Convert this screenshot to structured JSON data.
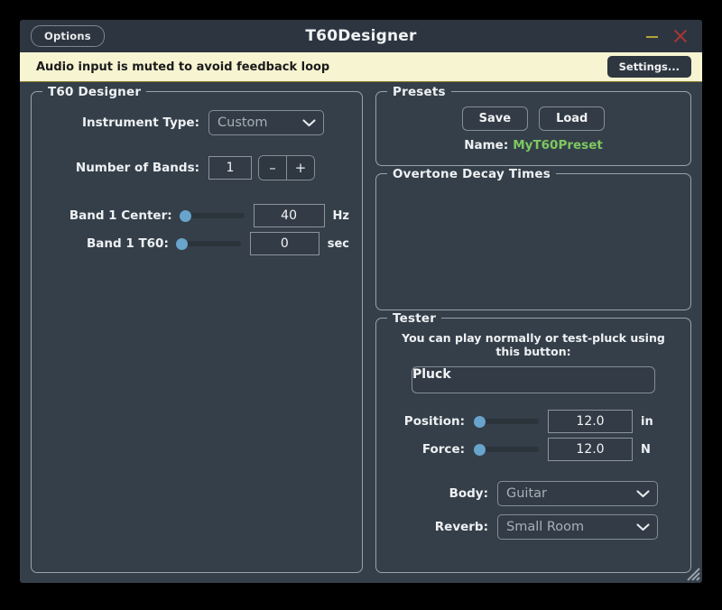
{
  "window": {
    "title": "T60Designer",
    "options_button": "Options",
    "minimize_icon": "minimize-icon",
    "close_icon": "close-icon"
  },
  "banner": {
    "message": "Audio input is muted to avoid feedback loop",
    "settings_button": "Settings...",
    "background_color": "#f7f4d2",
    "text_color": "#1b1b1b"
  },
  "designer": {
    "legend": "T60 Designer",
    "instrument_type_label": "Instrument Type:",
    "instrument_type_value": "Custom",
    "num_bands_label": "Number of Bands:",
    "num_bands_value": "1",
    "decrement_label": "–",
    "increment_label": "+",
    "bands": [
      {
        "center_label": "Band 1 Center:",
        "center_value": "40",
        "center_unit": "Hz",
        "center_slider_percent": 0,
        "t60_label": "Band 1 T60:",
        "t60_value": "0",
        "t60_unit": "sec",
        "t60_slider_percent": 0
      }
    ]
  },
  "presets": {
    "legend": "Presets",
    "save_button": "Save",
    "load_button": "Load",
    "name_label": "Name:",
    "name_value": "MyT60Preset",
    "name_color": "#7ec860"
  },
  "overtone": {
    "legend": "Overtone Decay Times",
    "items": []
  },
  "tester": {
    "legend": "Tester",
    "hint": "You can play normally or test-pluck using this button:",
    "pluck_button": "Pluck",
    "position_label": "Position:",
    "position_value": "12.0",
    "position_unit": "in",
    "position_slider_percent": 0,
    "force_label": "Force:",
    "force_value": "12.0",
    "force_unit": "N",
    "force_slider_percent": 0,
    "body_label": "Body:",
    "body_value": "Guitar",
    "reverb_label": "Reverb:",
    "reverb_value": "Small Room"
  },
  "theme": {
    "window_background": "#353f49",
    "titlebar_background": "#2d3640",
    "accent_slider": "#68a4cc",
    "border": "#9aa3ac",
    "text": "#eef1f3"
  }
}
